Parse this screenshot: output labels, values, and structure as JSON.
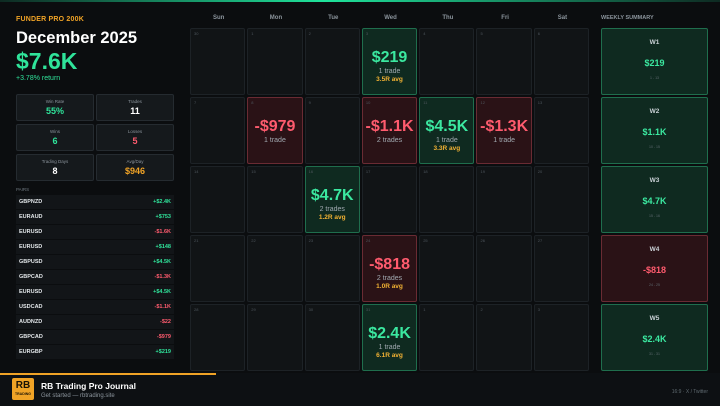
{
  "header": {
    "brand": "FUNDER PRO 200K",
    "month": "December 2025",
    "total": "$7.6K",
    "return": "+3.78% return"
  },
  "stats": [
    {
      "label": "Win Rate",
      "value": "55%",
      "color": "#2fe39a"
    },
    {
      "label": "Trades",
      "value": "11",
      "color": "#ffffff"
    },
    {
      "label": "Wins",
      "value": "6",
      "color": "#2fe39a"
    },
    {
      "label": "Losses",
      "value": "5",
      "color": "#ff5b6e"
    },
    {
      "label": "Trading Days",
      "value": "8",
      "color": "#ffffff"
    },
    {
      "label": "Avg/Day",
      "value": "$946",
      "color": "#f0a326"
    }
  ],
  "pairs_label": "PAIRS",
  "pairs": [
    {
      "name": "GBPNZD",
      "value": "+$2.4K",
      "color": "#2fe39a"
    },
    {
      "name": "EURAUD",
      "value": "+$753",
      "color": "#2fe39a"
    },
    {
      "name": "EURUSD",
      "value": "-$1.6K",
      "color": "#ff5b6e"
    },
    {
      "name": "EURUSD",
      "value": "+$148",
      "color": "#2fe39a"
    },
    {
      "name": "GBPUSD",
      "value": "+$4.5K",
      "color": "#2fe39a"
    },
    {
      "name": "GBPCAD",
      "value": "-$1.3K",
      "color": "#ff5b6e"
    },
    {
      "name": "EURUSD",
      "value": "+$4.5K",
      "color": "#2fe39a"
    },
    {
      "name": "USDCAD",
      "value": "-$1.1K",
      "color": "#ff5b6e"
    },
    {
      "name": "AUDNZD",
      "value": "-$22",
      "color": "#ff5b6e"
    },
    {
      "name": "GBPCAD",
      "value": "-$979",
      "color": "#ff5b6e"
    },
    {
      "name": "EURGBP",
      "value": "+$219",
      "color": "#2fe39a"
    }
  ],
  "calendar": {
    "days": [
      "Sun",
      "Mon",
      "Tue",
      "Wed",
      "Thu",
      "Fri",
      "Sat"
    ],
    "weeks": [
      [
        {
          "n": "30"
        },
        {
          "n": "1"
        },
        {
          "n": "2"
        },
        {
          "n": "3",
          "type": "pos",
          "amt": "$219",
          "tr": "1 trade",
          "avg": "3.5R avg"
        },
        {
          "n": "4"
        },
        {
          "n": "5"
        },
        {
          "n": "6"
        }
      ],
      [
        {
          "n": "7"
        },
        {
          "n": "8",
          "type": "neg",
          "amt": "-$979",
          "tr": "1 trade"
        },
        {
          "n": "9"
        },
        {
          "n": "10",
          "type": "neg",
          "amt": "-$1.1K",
          "tr": "2 trades"
        },
        {
          "n": "11",
          "type": "pos",
          "amt": "$4.5K",
          "tr": "1 trade",
          "avg": "3.3R avg"
        },
        {
          "n": "12",
          "type": "neg",
          "amt": "-$1.3K",
          "tr": "1 trade"
        },
        {
          "n": "13"
        }
      ],
      [
        {
          "n": "14"
        },
        {
          "n": "15"
        },
        {
          "n": "16",
          "type": "pos",
          "amt": "$4.7K",
          "tr": "2 trades",
          "avg": "1.2R avg"
        },
        {
          "n": "17"
        },
        {
          "n": "18"
        },
        {
          "n": "19"
        },
        {
          "n": "20"
        }
      ],
      [
        {
          "n": "21"
        },
        {
          "n": "22"
        },
        {
          "n": "23"
        },
        {
          "n": "24",
          "type": "neg",
          "amt": "-$818",
          "tr": "2 trades",
          "avg": "1.0R avg"
        },
        {
          "n": "25"
        },
        {
          "n": "26"
        },
        {
          "n": "27"
        }
      ],
      [
        {
          "n": "28"
        },
        {
          "n": "29"
        },
        {
          "n": "30"
        },
        {
          "n": "31",
          "type": "pos",
          "amt": "$2.4K",
          "tr": "1 trade",
          "avg": "6.1R avg"
        },
        {
          "n": "1"
        },
        {
          "n": "2"
        },
        {
          "n": "3"
        }
      ]
    ]
  },
  "weekly": {
    "title": "WEEKLY SUMMARY",
    "weeks": [
      {
        "label": "W1",
        "value": "$219",
        "dates": "1 - 13",
        "type": "pos"
      },
      {
        "label": "W2",
        "value": "$1.1K",
        "dates": "10 - 15",
        "type": "pos"
      },
      {
        "label": "W3",
        "value": "$4.7K",
        "dates": "15 - 16",
        "type": "pos"
      },
      {
        "label": "W4",
        "value": "-$818",
        "dates": "24 - 25",
        "type": "neg"
      },
      {
        "label": "W5",
        "value": "$2.4K",
        "dates": "31 - 31",
        "type": "pos"
      }
    ]
  },
  "footer": {
    "logo_main": "RB",
    "logo_sub": "TRADING",
    "title": "RB Trading Pro Journal",
    "subtitle": "Get started  —  rbtrading.site",
    "right": "16:9  ·  X / Twitter"
  }
}
